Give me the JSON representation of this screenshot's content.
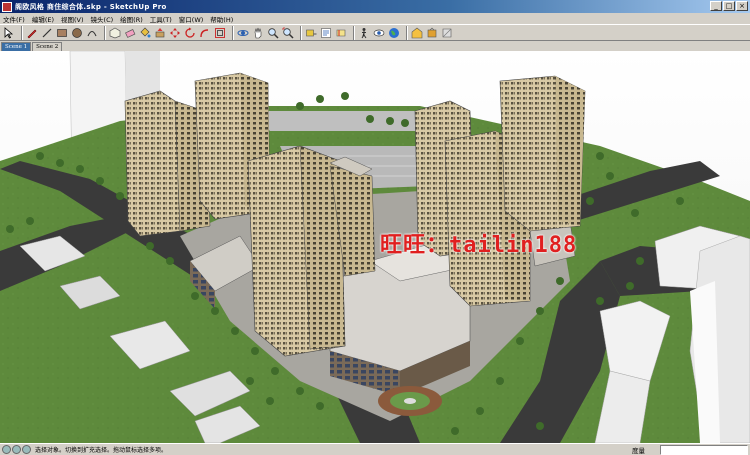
{
  "window": {
    "title": "阁欧风格 商住综合体.skp - SketchUp Pro",
    "buttons": [
      "_",
      "□",
      "×"
    ]
  },
  "menu": [
    "文件(F)",
    "编辑(E)",
    "视图(V)",
    "镜头(C)",
    "绘图(R)",
    "工具(T)",
    "窗口(W)",
    "帮助(H)"
  ],
  "toolbar": {
    "tools": [
      "select-icon",
      "pencil-icon",
      "line-icon",
      "rectangle-icon",
      "circle-icon",
      "arc-icon",
      "component-icon",
      "eraser-icon",
      "paint-bucket-icon",
      "pushpull-icon",
      "move-icon",
      "rotate-icon",
      "followme-icon",
      "offset-icon",
      "orbit-icon",
      "pan-icon",
      "zoom-icon",
      "zoom-extents-icon",
      "tape-measure-icon",
      "text-icon",
      "section-icon",
      "walk-icon",
      "look-around-icon",
      "google-earth-icon",
      "warehouse-icon",
      "share-icon",
      "styles-icon"
    ]
  },
  "scenes": {
    "tabs": [
      "Scene 1",
      "Scene 2"
    ],
    "active": 0
  },
  "viewport": {
    "watermark": "旺旺：tailin188"
  },
  "status": {
    "text": "选择对象。切换到扩充选择。拖动鼠标选择多项。",
    "measure_label": "度量",
    "measure_value": ""
  },
  "colors": {
    "title_bar": "#0a246a",
    "watermark": "#e02020",
    "ground": "#5e8a3c",
    "road": "#3a3a3a"
  }
}
